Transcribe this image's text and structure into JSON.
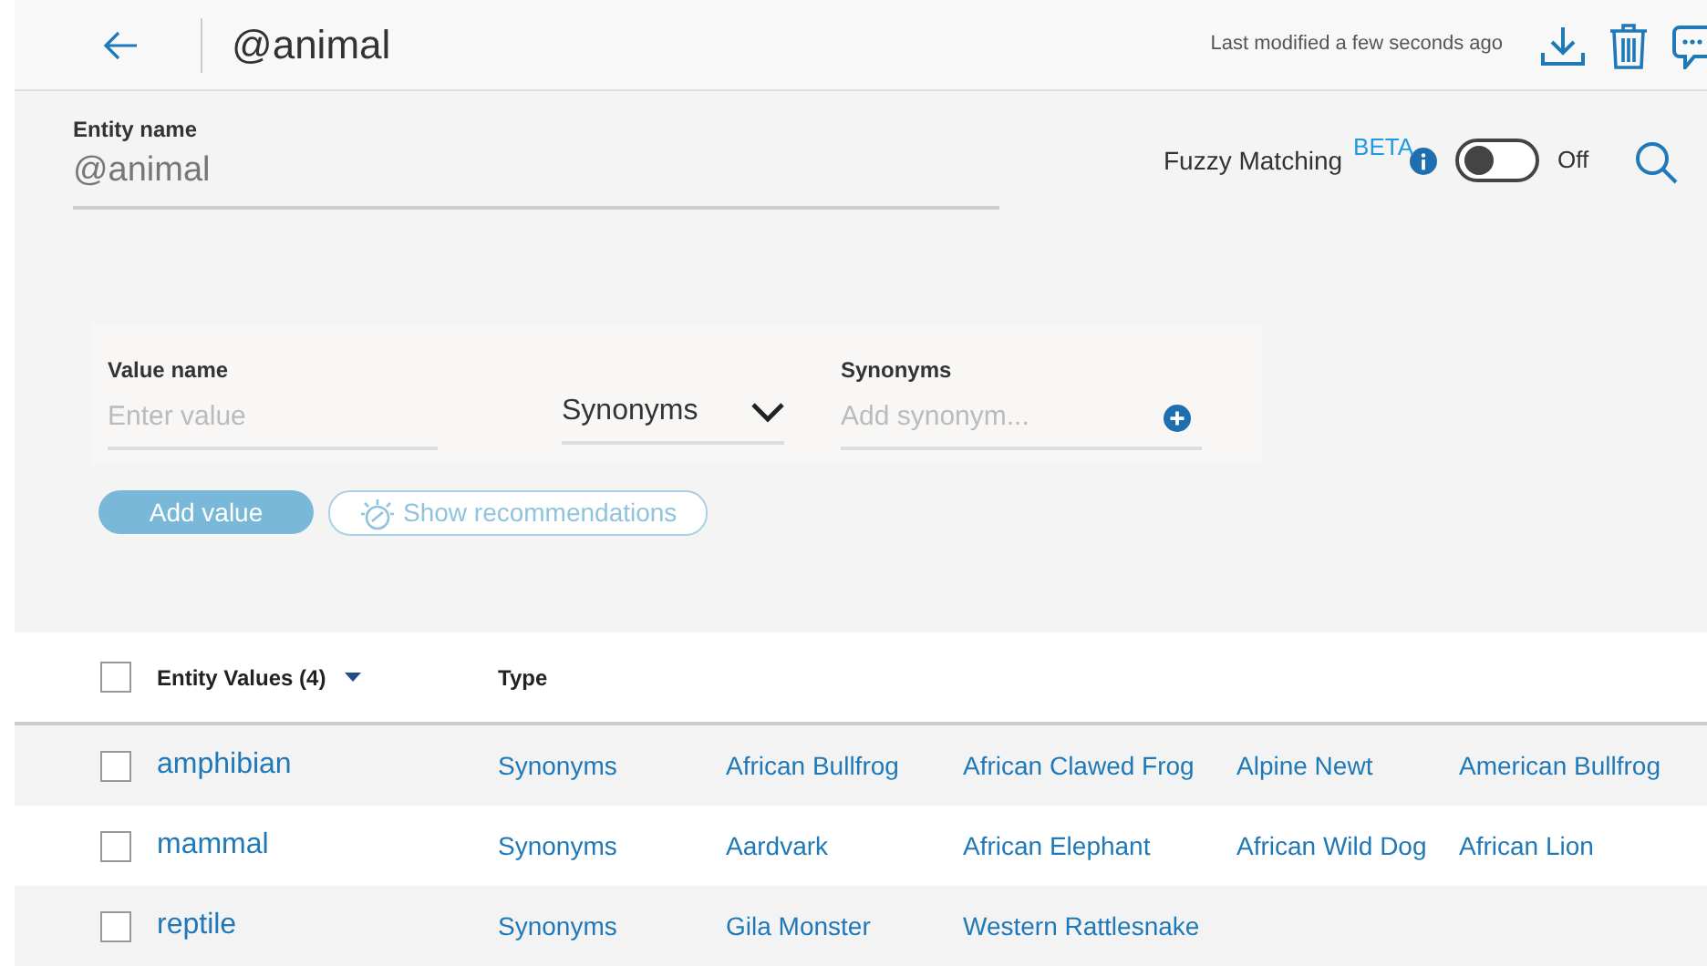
{
  "header": {
    "title": "@animal",
    "last_modified": "Last modified a few seconds ago"
  },
  "entity": {
    "label": "Entity name",
    "value": "@animal"
  },
  "fuzzy": {
    "label": "Fuzzy Matching",
    "badge": "BETA",
    "on": false,
    "state_text": "Off"
  },
  "form": {
    "value_label": "Value name",
    "value_placeholder": "Enter value",
    "type_select": "Synonyms",
    "synonyms_label": "Synonyms",
    "synonyms_placeholder": "Add synonym...",
    "add_button": "Add value",
    "recommend_button": "Show recommendations"
  },
  "table": {
    "all_checked": false,
    "columns": [
      "Entity Values (4)",
      "Type"
    ],
    "rows": [
      {
        "name": "amphibian",
        "checked": false,
        "type": "Synonyms",
        "synonyms": [
          "African Bullfrog",
          "African Clawed Frog",
          "Alpine Newt",
          "American Bullfrog"
        ]
      },
      {
        "name": "mammal",
        "checked": false,
        "type": "Synonyms",
        "synonyms": [
          "Aardvark",
          "African Elephant",
          "African Wild Dog",
          "African Lion"
        ]
      },
      {
        "name": "reptile",
        "checked": false,
        "type": "Synonyms",
        "synonyms": [
          "Gila Monster",
          "Western Rattlesnake"
        ]
      }
    ]
  }
}
